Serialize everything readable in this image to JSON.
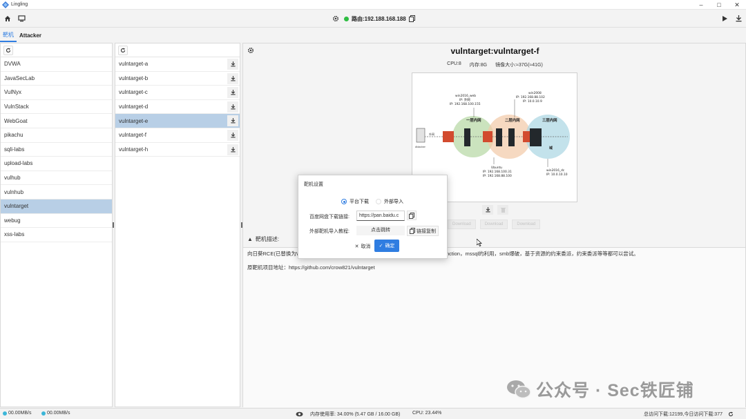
{
  "app": {
    "title": "Lingling"
  },
  "toolbar": {
    "route_label": "路由:192.188.168.188"
  },
  "tabs": [
    {
      "label": "靶机"
    },
    {
      "label": "Attacker"
    }
  ],
  "categories": [
    {
      "label": "DVWA"
    },
    {
      "label": "JavaSecLab"
    },
    {
      "label": "VulNyx"
    },
    {
      "label": "VulnStack"
    },
    {
      "label": "WebGoat"
    },
    {
      "label": "pikachu"
    },
    {
      "label": "sqli-labs"
    },
    {
      "label": "upload-labs"
    },
    {
      "label": "vulhub"
    },
    {
      "label": "vulnhub"
    },
    {
      "label": "vulntarget"
    },
    {
      "label": "webug"
    },
    {
      "label": "xss-labs"
    }
  ],
  "targets": [
    {
      "label": "vulntarget-a"
    },
    {
      "label": "vulntarget-b"
    },
    {
      "label": "vulntarget-c"
    },
    {
      "label": "vulntarget-d"
    },
    {
      "label": "vulntarget-e"
    },
    {
      "label": "vulntarget-f"
    },
    {
      "label": "vulntarget-h"
    }
  ],
  "detail": {
    "title": "vulntarget:vulntarget-f",
    "cpu": "CPU:8",
    "memory": "内存:8G",
    "image_size": "镜像大小:≈37G(≈41G)",
    "faded_buttons": [
      "Download",
      "Download",
      "Download"
    ],
    "desc_label": "靶机描述:",
    "desc_text": "向日葵RCE(已替换为Wi... 绕过... 浪宝塔，绕端口限制，出站规则探测，绕过disable_function，mssql的利用，smb爆破，基于资源的约束委派，约束委派等等都可以尝试。",
    "source_url": "原靶机项目地址：https://github.com/crow821/vulntarget"
  },
  "diagram": {
    "attacker": "Attacker",
    "outer_net": "外网",
    "web_name": "win2016_web",
    "web_ip1": "IP: 外网",
    "web_ip2": "IP: 192.168.100.155",
    "w2008_name": "win2008",
    "w2008_ip1": "IP: 192.168.88.102",
    "w2008_ip2": "IP: 10.0.10.9",
    "zone1": "一层内网",
    "zone2": "二层内网",
    "zone3": "三层内网",
    "domain": "域",
    "ubuntu_name": "Ubuntu",
    "ubuntu_ip1": "IP: 192.168.100.31",
    "ubuntu_ip2": "IP: 192.168.88.100",
    "dc_name": "win2016_dc",
    "dc_ip1": "IP: 10.0.10.10"
  },
  "modal": {
    "title": "靶机设置",
    "option_platform": "平台下载",
    "option_external": "外部导入",
    "link_label": "百度网盘下载链接:",
    "link_value": "https://pan.baidu.c",
    "tutorial_label": "外部靶机导入教程:",
    "jump_label": "点击跳转",
    "copy_link_label": "链接复制",
    "cancel_label": "取消",
    "ok_label": "确定"
  },
  "status": {
    "upload_speed": "00.00MB/s",
    "download_speed": "00.00MB/s",
    "memory_usage": "内存使用率: 34.00% (5.47 GB / 16.00 GB)",
    "cpu_usage": "CPU: 23.44%",
    "visits": "总访问下载:12199,今日访问下载:377"
  },
  "watermark": {
    "text": "公众号 · Sec铁匠铺"
  },
  "colors": {
    "accent": "#2f7de1",
    "selected_row": "#b8cfe6",
    "online": "#2ebd42"
  }
}
